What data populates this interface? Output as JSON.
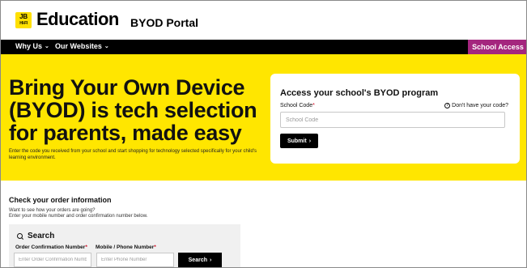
{
  "header": {
    "logo_top": "JB",
    "logo_bottom": "HI-FI",
    "brand": "Education",
    "portal": "BYOD Portal"
  },
  "nav": {
    "items": [
      {
        "label": "Why Us",
        "icon": "chevron-down-icon"
      },
      {
        "label": "Our Websites",
        "icon": "chevron-down-icon"
      }
    ],
    "school_access": "School Access",
    "chevron": "⌄"
  },
  "hero": {
    "title": "Bring Your Own Device (BYOD) is tech selection for parents, made easy",
    "subtitle": "Enter the code you received from your school and start shopping for technology selected specifically for your child's learning environment."
  },
  "access_card": {
    "title": "Access your school's BYOD program",
    "code_label": "School Code",
    "required_mark": "*",
    "help_text": "Don't have your code?",
    "help_icon_glyph": "?",
    "code_placeholder": "School Code",
    "submit_label": "Submit",
    "arrow": "›"
  },
  "order": {
    "title": "Check your order information",
    "sub1": "Want to see how your orders are going?",
    "sub2": "Enter your mobile number and order confirmation number below.",
    "search_heading": "Search",
    "order_label": "Order Confirmation Number",
    "phone_label": "Mobile / Phone Number",
    "required_mark": "*",
    "order_placeholder": "Enter Order Confirmation Number",
    "phone_placeholder": "Enter Phone Number",
    "search_button": "Search",
    "arrow": "›"
  },
  "colors": {
    "brand_yellow": "#ffe600",
    "school_access_purple": "#a4267e",
    "nav_black": "#000000",
    "required_red": "#d0021b"
  }
}
